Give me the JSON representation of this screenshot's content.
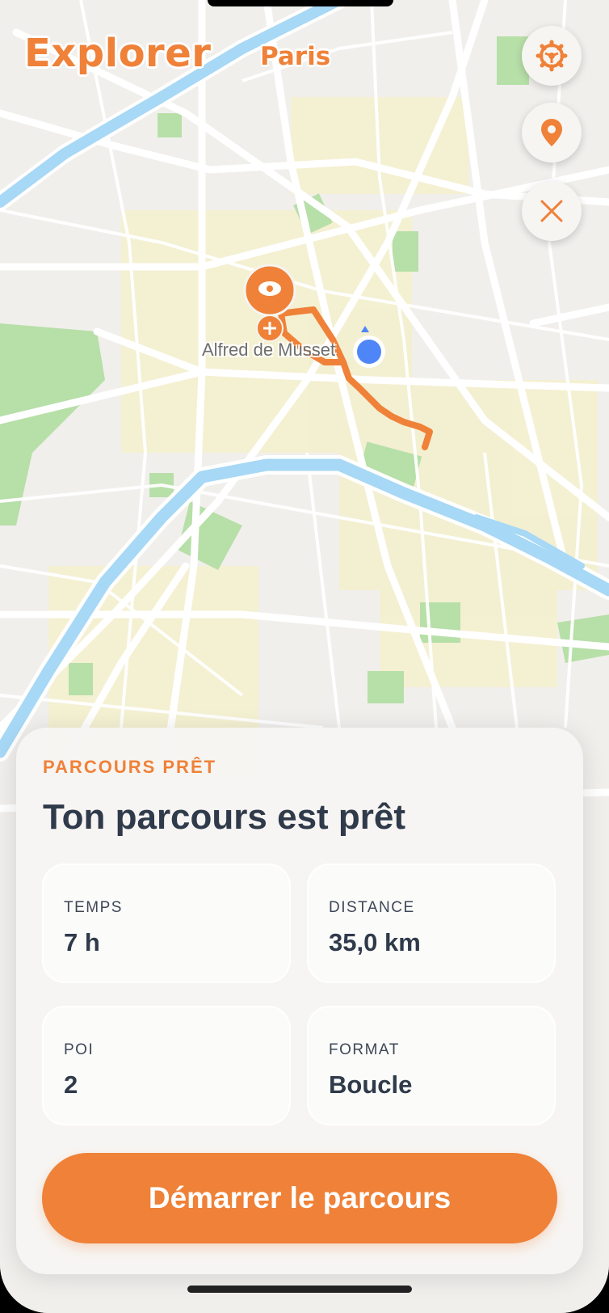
{
  "app": {
    "title": "Explorer",
    "city": "Paris"
  },
  "map": {
    "place_label": "Alfred de Musset",
    "route_color": "#ef8138",
    "user_location_color": "#4f86f7",
    "water_color": "#a7d8f5",
    "park_color": "#b7dfa8"
  },
  "controls": [
    {
      "icon": "gear-icon"
    },
    {
      "icon": "location-pin-icon"
    },
    {
      "icon": "close-icon"
    }
  ],
  "card": {
    "eyebrow": "PARCOURS PRÊT",
    "headline": "Ton parcours est prêt",
    "stats": [
      {
        "label": "TEMPS",
        "value": "7 h"
      },
      {
        "label": "DISTANCE",
        "value": "35,0 km"
      },
      {
        "label": "POI",
        "value": "2"
      },
      {
        "label": "FORMAT",
        "value": "Boucle"
      }
    ],
    "cta_label": "Démarrer le parcours"
  },
  "colors": {
    "accent": "#ef8138",
    "text_dark": "#2f3a4a"
  }
}
